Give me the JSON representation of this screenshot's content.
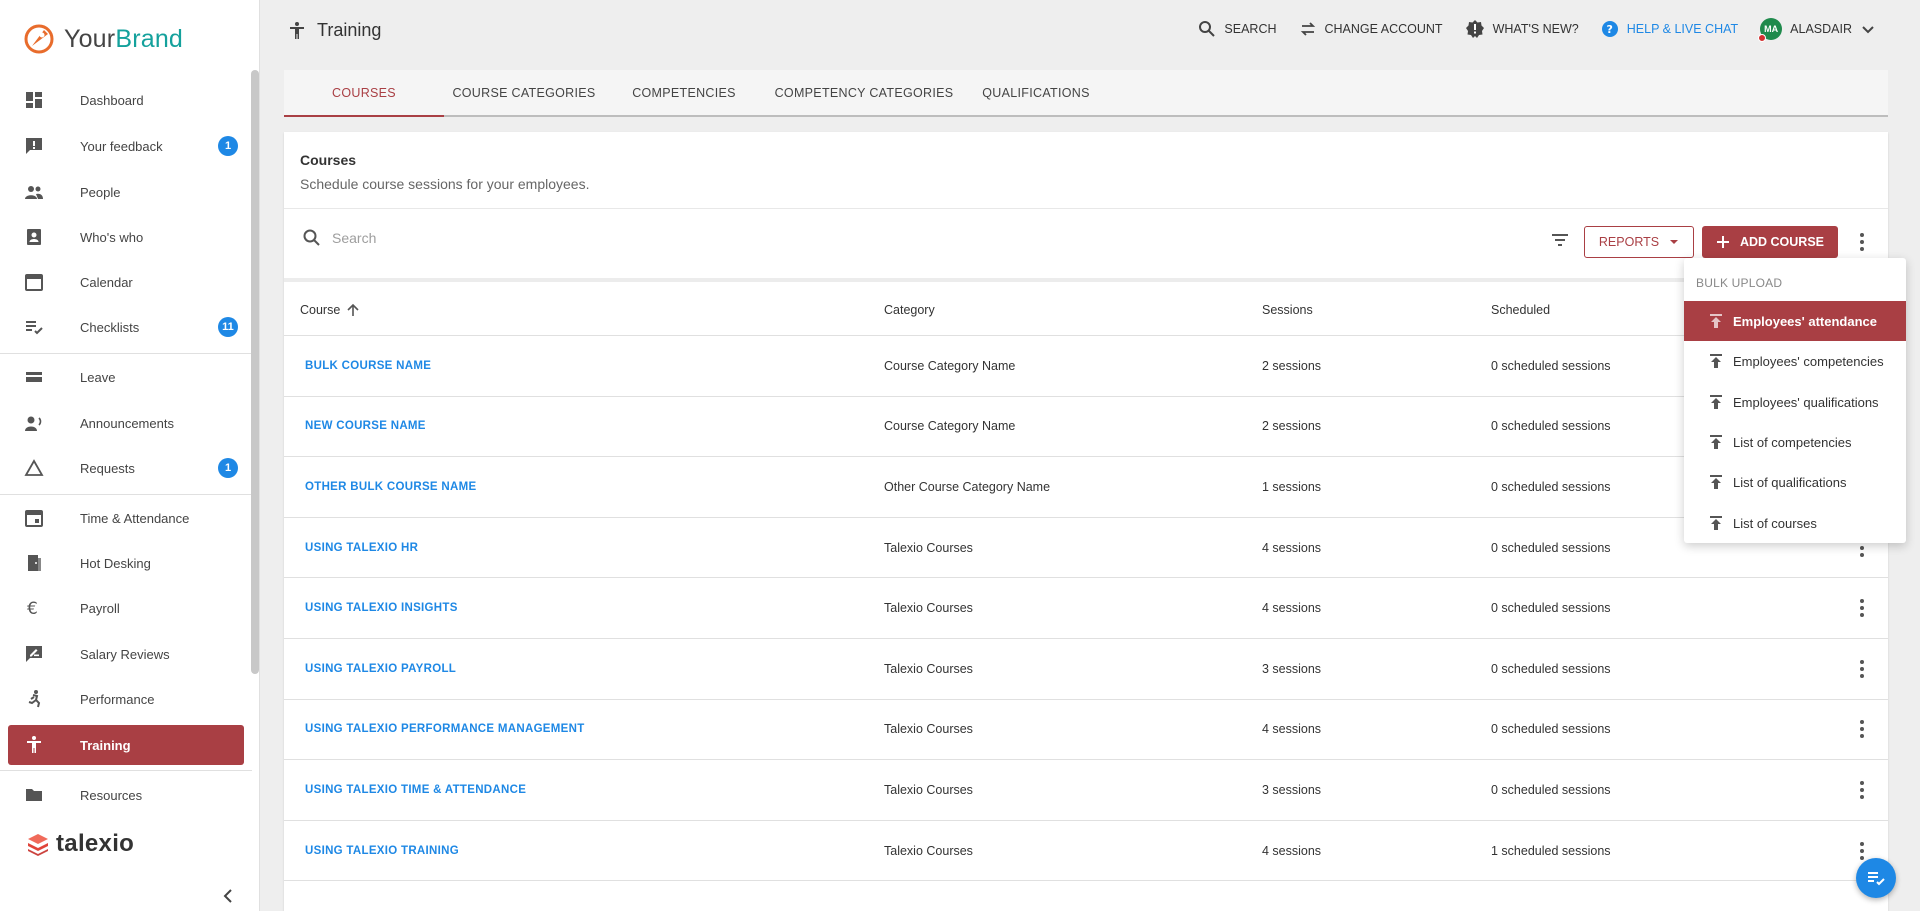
{
  "brand": {
    "name_part1": "Your",
    "name_part2": "Brand",
    "footer_logo": "talexio"
  },
  "sidebar": {
    "items": [
      {
        "label": "Dashboard",
        "icon": "dashboard-icon"
      },
      {
        "label": "Your feedback",
        "icon": "feedback-icon",
        "badge": "1"
      },
      {
        "label": "People",
        "icon": "people-icon"
      },
      {
        "label": "Who's who",
        "icon": "contact-card-icon"
      },
      {
        "label": "Calendar",
        "icon": "calendar-icon"
      },
      {
        "label": "Checklists",
        "icon": "checklist-icon",
        "badge": "11"
      },
      {
        "label": "Leave",
        "icon": "leave-icon"
      },
      {
        "label": "Announcements",
        "icon": "announcement-icon"
      },
      {
        "label": "Requests",
        "icon": "triangle-icon",
        "badge": "1"
      },
      {
        "label": "Time & Attendance",
        "icon": "event-icon"
      },
      {
        "label": "Hot Desking",
        "icon": "door-icon"
      },
      {
        "label": "Payroll",
        "icon": "euro-icon"
      },
      {
        "label": "Salary Reviews",
        "icon": "rate-review-icon"
      },
      {
        "label": "Performance",
        "icon": "run-icon"
      },
      {
        "label": "Training",
        "icon": "accessibility-icon",
        "active": true
      },
      {
        "label": "Resources",
        "icon": "folder-icon"
      }
    ]
  },
  "header": {
    "title": "Training",
    "search_label": "SEARCH",
    "change_account_label": "CHANGE ACCOUNT",
    "whats_new_label": "WHAT'S NEW?",
    "help_label": "HELP & LIVE CHAT",
    "user_initials": "MA",
    "user_name": "ALASDAIR"
  },
  "tabs": [
    "COURSES",
    "COURSE CATEGORIES",
    "COMPETENCIES",
    "COMPETENCY CATEGORIES",
    "QUALIFICATIONS"
  ],
  "courses_card": {
    "title": "Courses",
    "subtitle": "Schedule course sessions for your employees.",
    "search_placeholder": "Search",
    "reports_label": "REPORTS",
    "add_course_label": "ADD COURSE"
  },
  "table": {
    "columns": [
      "Course",
      "Category",
      "Sessions",
      "Scheduled"
    ],
    "rows": [
      {
        "course": "BULK COURSE NAME",
        "category": "Course Category Name",
        "sessions": "2 sessions",
        "scheduled": "0 scheduled sessions"
      },
      {
        "course": "NEW COURSE NAME",
        "category": "Course Category Name",
        "sessions": "2 sessions",
        "scheduled": "0 scheduled sessions"
      },
      {
        "course": "OTHER BULK COURSE NAME",
        "category": "Other Course Category Name",
        "sessions": "1 sessions",
        "scheduled": "0 scheduled sessions"
      },
      {
        "course": "USING TALEXIO HR",
        "category": "Talexio Courses",
        "sessions": "4 sessions",
        "scheduled": "0 scheduled sessions"
      },
      {
        "course": "USING TALEXIO INSIGHTS",
        "category": "Talexio Courses",
        "sessions": "4 sessions",
        "scheduled": "0 scheduled sessions"
      },
      {
        "course": "USING TALEXIO PAYROLL",
        "category": "Talexio Courses",
        "sessions": "3 sessions",
        "scheduled": "0 scheduled sessions"
      },
      {
        "course": "USING TALEXIO PERFORMANCE MANAGEMENT",
        "category": "Talexio Courses",
        "sessions": "4 sessions",
        "scheduled": "0 scheduled sessions"
      },
      {
        "course": "USING TALEXIO TIME & ATTENDANCE",
        "category": "Talexio Courses",
        "sessions": "3 sessions",
        "scheduled": "0 scheduled sessions"
      },
      {
        "course": "USING TALEXIO TRAINING",
        "category": "Talexio Courses",
        "sessions": "4 sessions",
        "scheduled": "1 scheduled sessions"
      }
    ]
  },
  "bulk_menu": {
    "heading": "BULK UPLOAD",
    "items": [
      "Employees' attendance",
      "Employees' competencies",
      "Employees' qualifications",
      "List of competencies",
      "List of qualifications",
      "List of courses"
    ]
  },
  "colors": {
    "accent": "#a93f44",
    "link": "#1e88e5",
    "badge": "#1e88e5",
    "brand_teal": "#14a19c"
  }
}
